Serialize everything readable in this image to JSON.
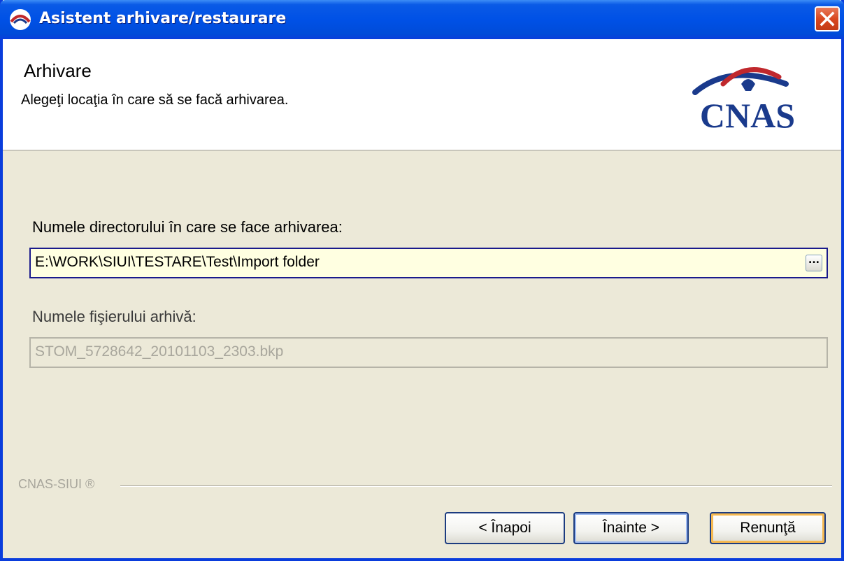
{
  "window": {
    "title": "Asistent arhivare/restaurare"
  },
  "header": {
    "title": "Arhivare",
    "subtitle": "Alegeţi locaţia în care să se facă arhivarea.",
    "logo_text": "CNAS"
  },
  "form": {
    "directory_label": "Numele directorului în care se face arhivarea:",
    "directory_value": "E:\\WORK\\SIUI\\TESTARE\\Test\\Import folder",
    "browse_label": "...",
    "filename_label": "Numele fişierului arhivă:",
    "filename_value": "STOM_5728642_20101103_2303.bkp"
  },
  "footer": {
    "divider_label": "CNAS-SIUI ®",
    "back_label": "< Înapoi",
    "next_label": "Înainte >",
    "cancel_label": "Renunţă"
  },
  "colors": {
    "titlebar": "#0051e6",
    "dialog_bg": "#ece9d8",
    "active_input_bg": "#ffffe1",
    "close_button": "#d9471f",
    "logo_blue": "#1a3a8c",
    "logo_red": "#c0282d"
  }
}
